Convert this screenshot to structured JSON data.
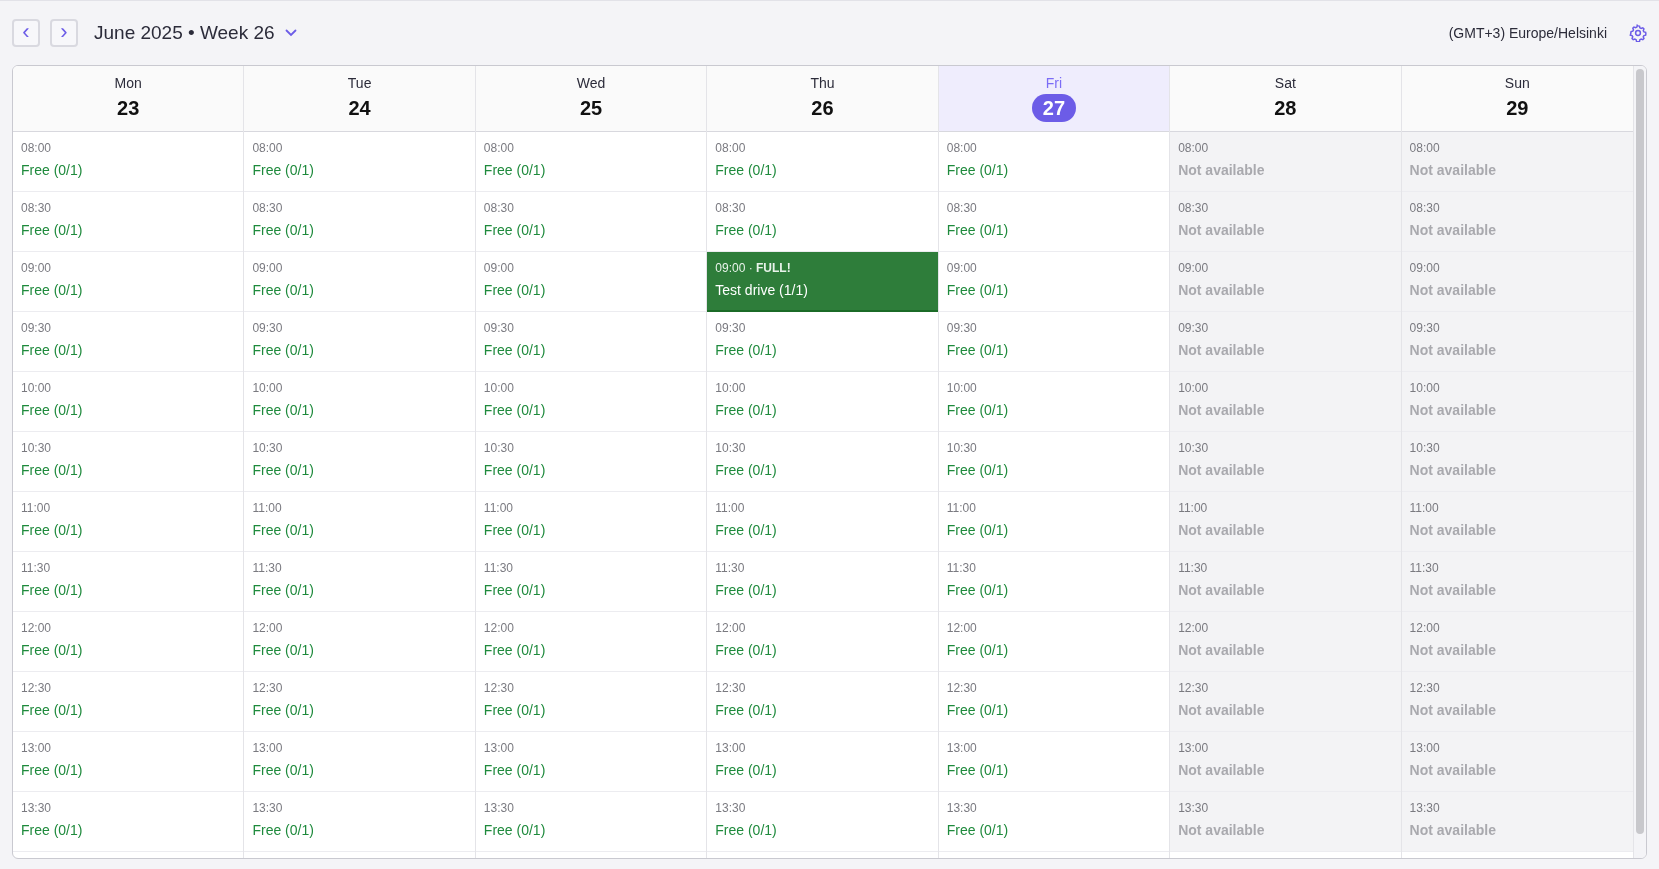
{
  "toolbar": {
    "prev_label": "‹",
    "next_label": "›",
    "title": "June 2025 • Week 26",
    "timezone": "(GMT+3) Europe/Helsinki"
  },
  "days": [
    {
      "weekday": "Mon",
      "date": "23",
      "selected": false,
      "slots": [
        {
          "kind": "free",
          "time": "08:00",
          "label": "Free (0/1)"
        },
        {
          "kind": "free",
          "time": "08:30",
          "label": "Free (0/1)"
        },
        {
          "kind": "free",
          "time": "09:00",
          "label": "Free (0/1)"
        },
        {
          "kind": "free",
          "time": "09:30",
          "label": "Free (0/1)"
        },
        {
          "kind": "free",
          "time": "10:00",
          "label": "Free (0/1)"
        },
        {
          "kind": "free",
          "time": "10:30",
          "label": "Free (0/1)"
        },
        {
          "kind": "free",
          "time": "11:00",
          "label": "Free (0/1)"
        },
        {
          "kind": "free",
          "time": "11:30",
          "label": "Free (0/1)"
        },
        {
          "kind": "free",
          "time": "12:00",
          "label": "Free (0/1)"
        },
        {
          "kind": "free",
          "time": "12:30",
          "label": "Free (0/1)"
        },
        {
          "kind": "free",
          "time": "13:00",
          "label": "Free (0/1)"
        },
        {
          "kind": "free",
          "time": "13:30",
          "label": "Free (0/1)"
        }
      ]
    },
    {
      "weekday": "Tue",
      "date": "24",
      "selected": false,
      "slots": [
        {
          "kind": "free",
          "time": "08:00",
          "label": "Free (0/1)"
        },
        {
          "kind": "free",
          "time": "08:30",
          "label": "Free (0/1)"
        },
        {
          "kind": "free",
          "time": "09:00",
          "label": "Free (0/1)"
        },
        {
          "kind": "free",
          "time": "09:30",
          "label": "Free (0/1)"
        },
        {
          "kind": "free",
          "time": "10:00",
          "label": "Free (0/1)"
        },
        {
          "kind": "free",
          "time": "10:30",
          "label": "Free (0/1)"
        },
        {
          "kind": "free",
          "time": "11:00",
          "label": "Free (0/1)"
        },
        {
          "kind": "free",
          "time": "11:30",
          "label": "Free (0/1)"
        },
        {
          "kind": "free",
          "time": "12:00",
          "label": "Free (0/1)"
        },
        {
          "kind": "free",
          "time": "12:30",
          "label": "Free (0/1)"
        },
        {
          "kind": "free",
          "time": "13:00",
          "label": "Free (0/1)"
        },
        {
          "kind": "free",
          "time": "13:30",
          "label": "Free (0/1)"
        }
      ]
    },
    {
      "weekday": "Wed",
      "date": "25",
      "selected": false,
      "slots": [
        {
          "kind": "free",
          "time": "08:00",
          "label": "Free (0/1)"
        },
        {
          "kind": "free",
          "time": "08:30",
          "label": "Free (0/1)"
        },
        {
          "kind": "free",
          "time": "09:00",
          "label": "Free (0/1)"
        },
        {
          "kind": "free",
          "time": "09:30",
          "label": "Free (0/1)"
        },
        {
          "kind": "free",
          "time": "10:00",
          "label": "Free (0/1)"
        },
        {
          "kind": "free",
          "time": "10:30",
          "label": "Free (0/1)"
        },
        {
          "kind": "free",
          "time": "11:00",
          "label": "Free (0/1)"
        },
        {
          "kind": "free",
          "time": "11:30",
          "label": "Free (0/1)"
        },
        {
          "kind": "free",
          "time": "12:00",
          "label": "Free (0/1)"
        },
        {
          "kind": "free",
          "time": "12:30",
          "label": "Free (0/1)"
        },
        {
          "kind": "free",
          "time": "13:00",
          "label": "Free (0/1)"
        },
        {
          "kind": "free",
          "time": "13:30",
          "label": "Free (0/1)"
        }
      ]
    },
    {
      "weekday": "Thu",
      "date": "26",
      "selected": false,
      "slots": [
        {
          "kind": "free",
          "time": "08:00",
          "label": "Free (0/1)"
        },
        {
          "kind": "free",
          "time": "08:30",
          "label": "Free (0/1)"
        },
        {
          "kind": "full",
          "time": "09:00 · **FULL!**",
          "label": "Test drive (1/1)"
        },
        {
          "kind": "free",
          "time": "09:30",
          "label": "Free (0/1)"
        },
        {
          "kind": "free",
          "time": "10:00",
          "label": "Free (0/1)"
        },
        {
          "kind": "free",
          "time": "10:30",
          "label": "Free (0/1)"
        },
        {
          "kind": "free",
          "time": "11:00",
          "label": "Free (0/1)"
        },
        {
          "kind": "free",
          "time": "11:30",
          "label": "Free (0/1)"
        },
        {
          "kind": "free",
          "time": "12:00",
          "label": "Free (0/1)"
        },
        {
          "kind": "free",
          "time": "12:30",
          "label": "Free (0/1)"
        },
        {
          "kind": "free",
          "time": "13:00",
          "label": "Free (0/1)"
        },
        {
          "kind": "free",
          "time": "13:30",
          "label": "Free (0/1)"
        }
      ]
    },
    {
      "weekday": "Fri",
      "date": "27",
      "selected": true,
      "slots": [
        {
          "kind": "free",
          "time": "08:00",
          "label": "Free (0/1)"
        },
        {
          "kind": "free",
          "time": "08:30",
          "label": "Free (0/1)"
        },
        {
          "kind": "free",
          "time": "09:00",
          "label": "Free (0/1)"
        },
        {
          "kind": "free",
          "time": "09:30",
          "label": "Free (0/1)"
        },
        {
          "kind": "free",
          "time": "10:00",
          "label": "Free (0/1)"
        },
        {
          "kind": "free",
          "time": "10:30",
          "label": "Free (0/1)"
        },
        {
          "kind": "free",
          "time": "11:00",
          "label": "Free (0/1)"
        },
        {
          "kind": "free",
          "time": "11:30",
          "label": "Free (0/1)"
        },
        {
          "kind": "free",
          "time": "12:00",
          "label": "Free (0/1)"
        },
        {
          "kind": "free",
          "time": "12:30",
          "label": "Free (0/1)"
        },
        {
          "kind": "free",
          "time": "13:00",
          "label": "Free (0/1)"
        },
        {
          "kind": "free",
          "time": "13:30",
          "label": "Free (0/1)"
        }
      ]
    },
    {
      "weekday": "Sat",
      "date": "28",
      "selected": false,
      "slots": [
        {
          "kind": "unavailable",
          "time": "08:00",
          "label": "Not available"
        },
        {
          "kind": "unavailable",
          "time": "08:30",
          "label": "Not available"
        },
        {
          "kind": "unavailable",
          "time": "09:00",
          "label": "Not available"
        },
        {
          "kind": "unavailable",
          "time": "09:30",
          "label": "Not available"
        },
        {
          "kind": "unavailable",
          "time": "10:00",
          "label": "Not available"
        },
        {
          "kind": "unavailable",
          "time": "10:30",
          "label": "Not available"
        },
        {
          "kind": "unavailable",
          "time": "11:00",
          "label": "Not available"
        },
        {
          "kind": "unavailable",
          "time": "11:30",
          "label": "Not available"
        },
        {
          "kind": "unavailable",
          "time": "12:00",
          "label": "Not available"
        },
        {
          "kind": "unavailable",
          "time": "12:30",
          "label": "Not available"
        },
        {
          "kind": "unavailable",
          "time": "13:00",
          "label": "Not available"
        },
        {
          "kind": "unavailable",
          "time": "13:30",
          "label": "Not available"
        }
      ]
    },
    {
      "weekday": "Sun",
      "date": "29",
      "selected": false,
      "slots": [
        {
          "kind": "unavailable",
          "time": "08:00",
          "label": "Not available"
        },
        {
          "kind": "unavailable",
          "time": "08:30",
          "label": "Not available"
        },
        {
          "kind": "unavailable",
          "time": "09:00",
          "label": "Not available"
        },
        {
          "kind": "unavailable",
          "time": "09:30",
          "label": "Not available"
        },
        {
          "kind": "unavailable",
          "time": "10:00",
          "label": "Not available"
        },
        {
          "kind": "unavailable",
          "time": "10:30",
          "label": "Not available"
        },
        {
          "kind": "unavailable",
          "time": "11:00",
          "label": "Not available"
        },
        {
          "kind": "unavailable",
          "time": "11:30",
          "label": "Not available"
        },
        {
          "kind": "unavailable",
          "time": "12:00",
          "label": "Not available"
        },
        {
          "kind": "unavailable",
          "time": "12:30",
          "label": "Not available"
        },
        {
          "kind": "unavailable",
          "time": "13:00",
          "label": "Not available"
        },
        {
          "kind": "unavailable",
          "time": "13:30",
          "label": "Not available"
        }
      ]
    }
  ]
}
